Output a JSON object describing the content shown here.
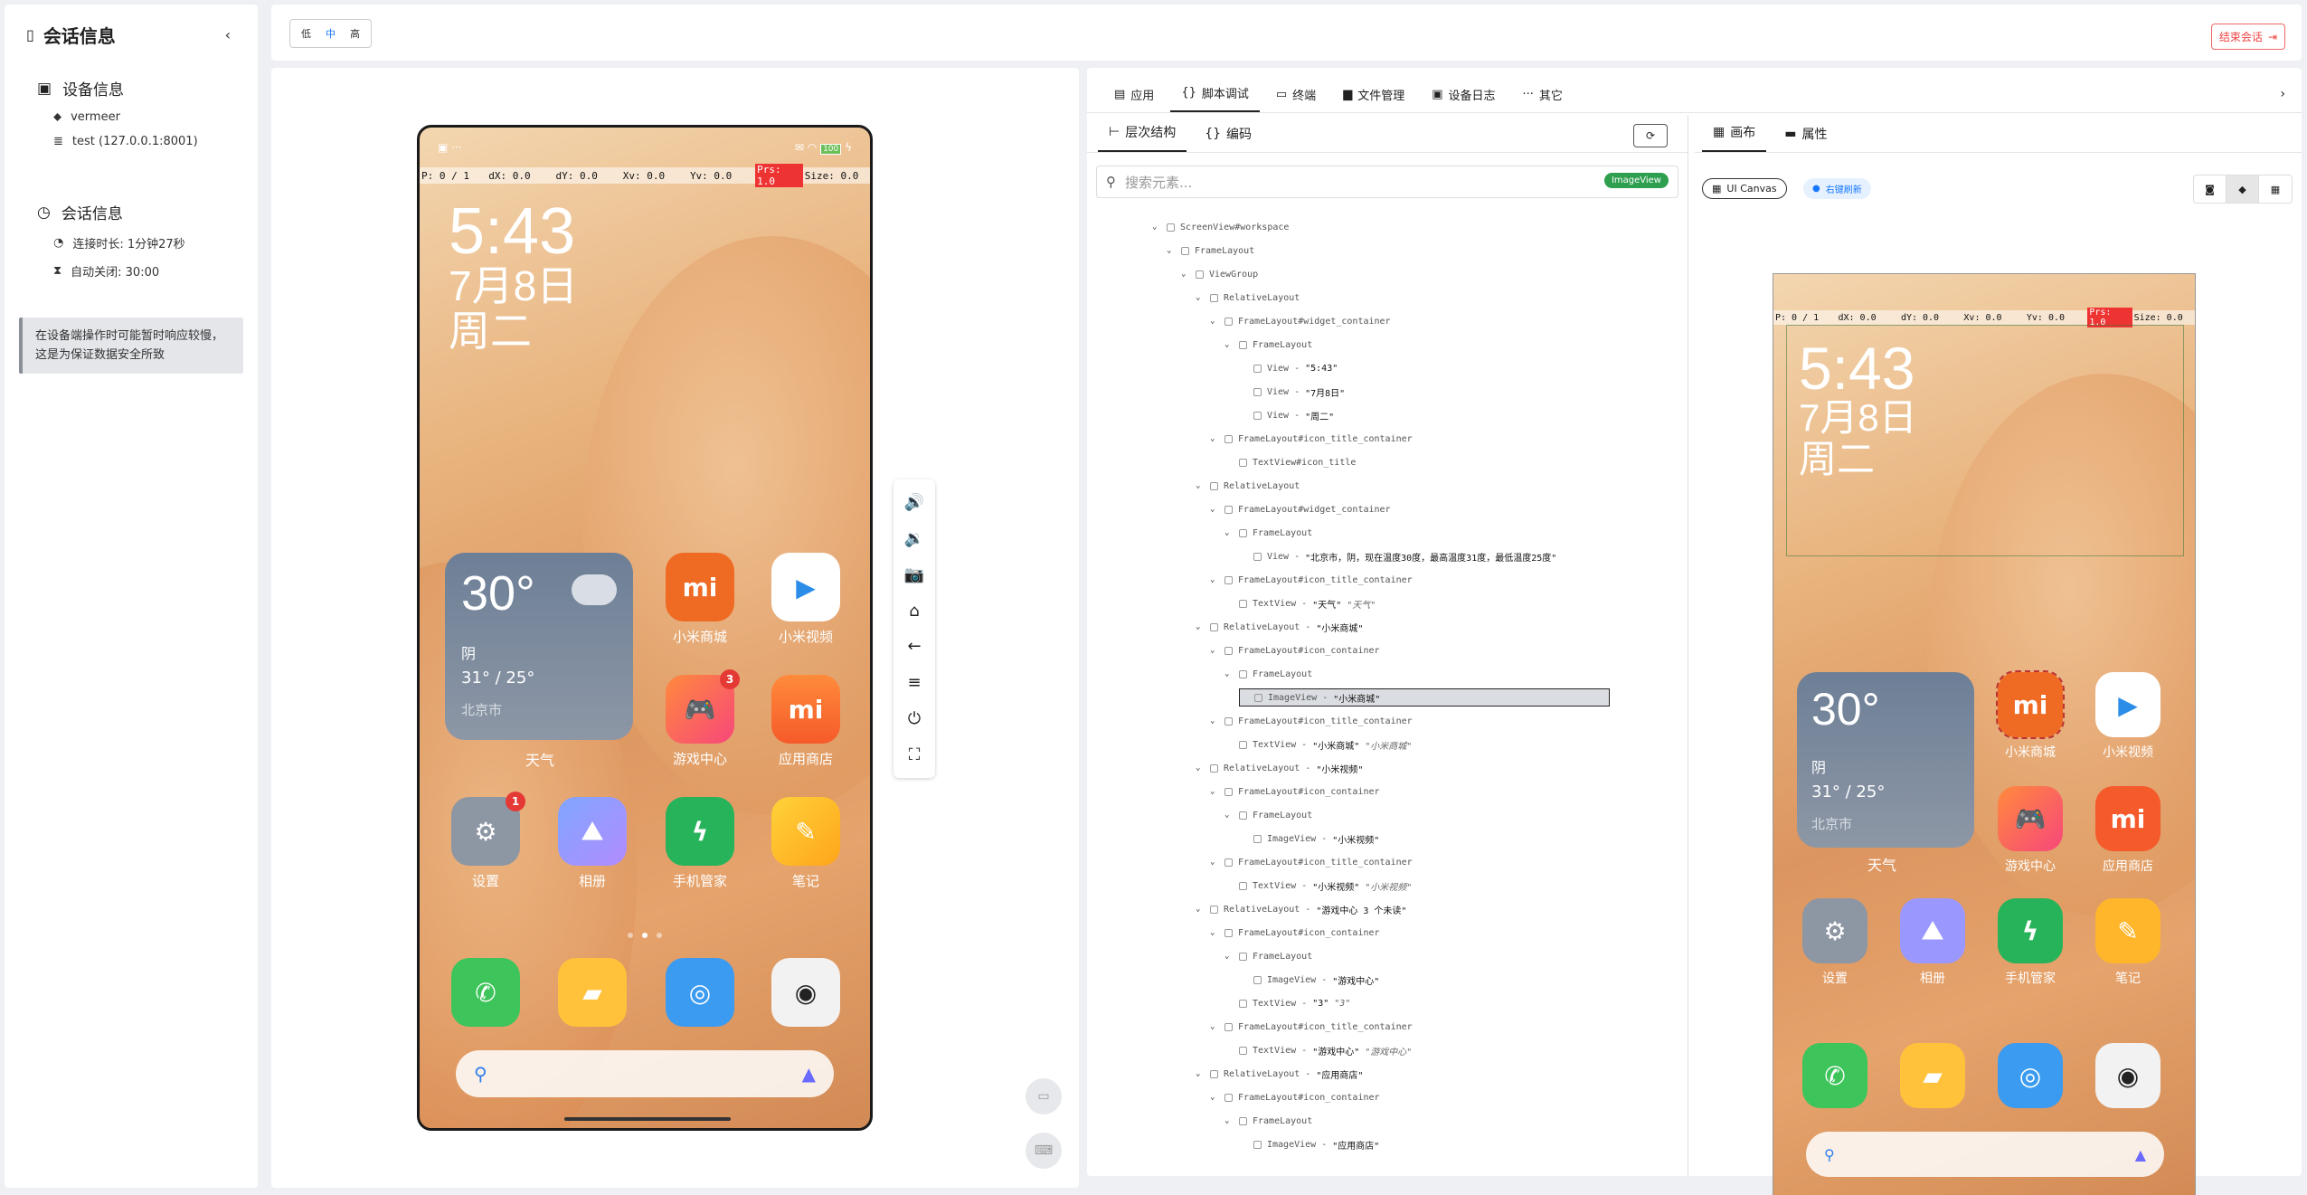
{
  "sidebar": {
    "title": "会话信息",
    "collapse_icon": "chevron-left-icon",
    "device_section_title": "设备信息",
    "device_model": "vermeer",
    "device_server": "test (127.0.0.1:8001)",
    "session_section_title": "会话信息",
    "connect_duration": "连接时长: 1分钟27秒",
    "auto_close": "自动关闭: 30:00",
    "notice": "在设备端操作时可能暂时响应较慢，这是为保证数据安全所致"
  },
  "topbar": {
    "quality_options": [
      "低",
      "中",
      "高"
    ],
    "quality_selected": "中",
    "end_session_label": "结束会话"
  },
  "phone": {
    "pointer_bar": [
      "P: 0 / 1",
      "dX: 0.0",
      "dY: 0.0",
      "Xv: 0.0",
      "Yv: 0.0",
      "Prs: 1.0",
      "Size: 0.0"
    ],
    "time": "5:43",
    "date": "7月8日",
    "weekday": "周二",
    "battery": "100",
    "weather": {
      "temp": "30°",
      "condition": "阴",
      "range": "31° / 25°",
      "city": "北京市",
      "label": "天气"
    },
    "apps_row1": [
      {
        "name": "小米商城",
        "icon_text": "mi"
      },
      {
        "name": "小米视频",
        "icon_text": "▶"
      }
    ],
    "apps_row2": [
      {
        "name": "游戏中心",
        "badge": "3"
      },
      {
        "name": "应用商店",
        "icon_text": "mi"
      }
    ],
    "apps_row3": [
      {
        "name": "设置",
        "badge": "1"
      },
      {
        "name": "相册"
      },
      {
        "name": "手机管家"
      },
      {
        "name": "笔记"
      }
    ],
    "dock": [
      "phone-icon",
      "message-icon",
      "browser-icon",
      "camera-icon"
    ]
  },
  "device_controls": [
    "volume-up-icon",
    "volume-down-icon",
    "camera-icon",
    "home-icon",
    "back-icon",
    "menu-icon",
    "power-icon",
    "fullscreen-icon"
  ],
  "tools": {
    "tabs": [
      "应用",
      "脚本调试",
      "终端",
      "文件管理",
      "设备日志",
      "其它"
    ],
    "active_tab": "脚本调试",
    "tree_tabs": [
      "层次结构",
      "编码"
    ],
    "canvas_tabs": [
      "画布",
      "属性"
    ],
    "search_placeholder": "搜索元素...",
    "search_chip": "ImageView",
    "canvas_mode": "UI Canvas",
    "canvas_hint": "右键刷新"
  },
  "tree": [
    {
      "d": 2,
      "t": "ScreenView#workspace"
    },
    {
      "d": 3,
      "t": "FrameLayout"
    },
    {
      "d": 4,
      "t": "ViewGroup"
    },
    {
      "d": 5,
      "t": "RelativeLayout"
    },
    {
      "d": 6,
      "t": "FrameLayout#widget_container"
    },
    {
      "d": 7,
      "t": "FrameLayout"
    },
    {
      "d": 8,
      "t": "View - ",
      "v": "\"5:43\""
    },
    {
      "d": 8,
      "t": "View - ",
      "v": "\"7月8日\""
    },
    {
      "d": 8,
      "t": "View - ",
      "v": "\"周二\""
    },
    {
      "d": 6,
      "t": "FrameLayout#icon_title_container"
    },
    {
      "d": 7,
      "t": "TextView#icon_title"
    },
    {
      "d": 5,
      "t": "RelativeLayout"
    },
    {
      "d": 6,
      "t": "FrameLayout#widget_container"
    },
    {
      "d": 7,
      "t": "FrameLayout"
    },
    {
      "d": 8,
      "t": "View - ",
      "v": "\"北京市，阴，现在温度30度，最高温度31度，最低温度25度\""
    },
    {
      "d": 6,
      "t": "FrameLayout#icon_title_container"
    },
    {
      "d": 7,
      "t": "TextView - ",
      "v": "\"天气\"",
      "x": "\"天气\""
    },
    {
      "d": 5,
      "t": "RelativeLayout - ",
      "v": "\"小米商城\""
    },
    {
      "d": 6,
      "t": "FrameLayout#icon_container"
    },
    {
      "d": 7,
      "t": "FrameLayout"
    },
    {
      "d": 8,
      "t": "ImageView - ",
      "v": "\"小米商城\"",
      "sel": true
    },
    {
      "d": 6,
      "t": "FrameLayout#icon_title_container"
    },
    {
      "d": 7,
      "t": "TextView - ",
      "v": "\"小米商城\"",
      "x": "\"小米商城\""
    },
    {
      "d": 5,
      "t": "RelativeLayout - ",
      "v": "\"小米视频\""
    },
    {
      "d": 6,
      "t": "FrameLayout#icon_container"
    },
    {
      "d": 7,
      "t": "FrameLayout"
    },
    {
      "d": 8,
      "t": "ImageView - ",
      "v": "\"小米视频\""
    },
    {
      "d": 6,
      "t": "FrameLayout#icon_title_container"
    },
    {
      "d": 7,
      "t": "TextView - ",
      "v": "\"小米视频\"",
      "x": "\"小米视频\""
    },
    {
      "d": 5,
      "t": "RelativeLayout - ",
      "v": "\"游戏中心 3 个未读\""
    },
    {
      "d": 6,
      "t": "FrameLayout#icon_container"
    },
    {
      "d": 7,
      "t": "FrameLayout"
    },
    {
      "d": 8,
      "t": "ImageView - ",
      "v": "\"游戏中心\""
    },
    {
      "d": 7,
      "t": "TextView - ",
      "v": "\"3\"",
      "x": "\"3\""
    },
    {
      "d": 6,
      "t": "FrameLayout#icon_title_container"
    },
    {
      "d": 7,
      "t": "TextView - ",
      "v": "\"游戏中心\"",
      "x": "\"游戏中心\""
    },
    {
      "d": 5,
      "t": "RelativeLayout - ",
      "v": "\"应用商店\""
    },
    {
      "d": 6,
      "t": "FrameLayout#icon_container"
    },
    {
      "d": 7,
      "t": "FrameLayout"
    },
    {
      "d": 8,
      "t": "ImageView - ",
      "v": "\"应用商店\""
    }
  ]
}
